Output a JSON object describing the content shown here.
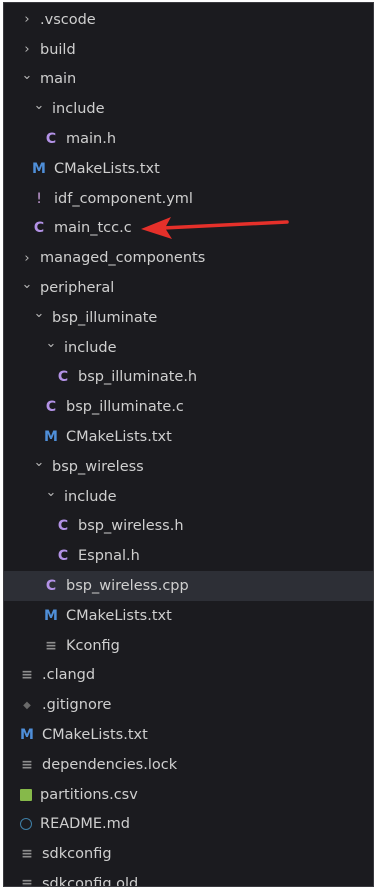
{
  "explorer": {
    "items": [
      {
        "label": ".vscode",
        "kind": "folder",
        "expanded": false,
        "depth": 0
      },
      {
        "label": "build",
        "kind": "folder",
        "expanded": false,
        "depth": 0
      },
      {
        "label": "main",
        "kind": "folder",
        "expanded": true,
        "depth": 0
      },
      {
        "label": "include",
        "kind": "folder",
        "expanded": true,
        "depth": 1
      },
      {
        "label": "main.h",
        "kind": "file",
        "icon": "c-file-icon",
        "glyph": "C",
        "depth": 2
      },
      {
        "label": "CMakeLists.txt",
        "kind": "file",
        "icon": "cmake-file-icon",
        "glyph": "M",
        "depth": 1
      },
      {
        "label": "idf_component.yml",
        "kind": "file",
        "icon": "yaml-file-icon",
        "glyph": "!",
        "depth": 1
      },
      {
        "label": "main_tcc.c",
        "kind": "file",
        "icon": "c-file-icon",
        "glyph": "C",
        "depth": 1
      },
      {
        "label": "managed_components",
        "kind": "folder",
        "expanded": false,
        "depth": 0
      },
      {
        "label": "peripheral",
        "kind": "folder",
        "expanded": true,
        "depth": 0
      },
      {
        "label": "bsp_illuminate",
        "kind": "folder",
        "expanded": true,
        "depth": 1
      },
      {
        "label": "include",
        "kind": "folder",
        "expanded": true,
        "depth": 2
      },
      {
        "label": "bsp_illuminate.h",
        "kind": "file",
        "icon": "c-file-icon",
        "glyph": "C",
        "depth": 3
      },
      {
        "label": "bsp_illuminate.c",
        "kind": "file",
        "icon": "c-file-icon",
        "glyph": "C",
        "depth": 2
      },
      {
        "label": "CMakeLists.txt",
        "kind": "file",
        "icon": "cmake-file-icon",
        "glyph": "M",
        "depth": 2
      },
      {
        "label": "bsp_wireless",
        "kind": "folder",
        "expanded": true,
        "depth": 1
      },
      {
        "label": "include",
        "kind": "folder",
        "expanded": true,
        "depth": 2
      },
      {
        "label": "bsp_wireless.h",
        "kind": "file",
        "icon": "c-file-icon",
        "glyph": "C",
        "depth": 3
      },
      {
        "label": "Espnal.h",
        "kind": "file",
        "icon": "c-file-icon",
        "glyph": "C",
        "depth": 3
      },
      {
        "label": "bsp_wireless.cpp",
        "kind": "file",
        "icon": "cpp-file-icon",
        "glyph": "C",
        "depth": 2,
        "selected": true
      },
      {
        "label": "CMakeLists.txt",
        "kind": "file",
        "icon": "cmake-file-icon",
        "glyph": "M",
        "depth": 2
      },
      {
        "label": "Kconfig",
        "kind": "file",
        "icon": "config-file-icon",
        "glyph": "≡",
        "depth": 2
      },
      {
        "label": ".clangd",
        "kind": "file",
        "icon": "config-file-icon",
        "glyph": "≡",
        "depth": 0
      },
      {
        "label": ".gitignore",
        "kind": "file",
        "icon": "git-file-icon",
        "glyph": "◆",
        "depth": 0
      },
      {
        "label": "CMakeLists.txt",
        "kind": "file",
        "icon": "cmake-file-icon",
        "glyph": "M",
        "depth": 0
      },
      {
        "label": "dependencies.lock",
        "kind": "file",
        "icon": "config-file-icon",
        "glyph": "≡",
        "depth": 0
      },
      {
        "label": "partitions.csv",
        "kind": "file",
        "icon": "csv-file-icon",
        "glyph": "",
        "depth": 0
      },
      {
        "label": "README.md",
        "kind": "file",
        "icon": "info-file-icon",
        "glyph": "",
        "depth": 0
      },
      {
        "label": "sdkconfig",
        "kind": "file",
        "icon": "config-file-icon",
        "glyph": "≡",
        "depth": 0
      },
      {
        "label": "sdkconfig.old",
        "kind": "file",
        "icon": "config-file-icon",
        "glyph": "≡",
        "depth": 0
      }
    ]
  },
  "colors": {
    "background": "#1b1b1f",
    "selected_row": "#2d2f36",
    "arrow": "#e5302a",
    "c_icon": "#b392e6",
    "cmake_icon": "#4f8fd9"
  }
}
